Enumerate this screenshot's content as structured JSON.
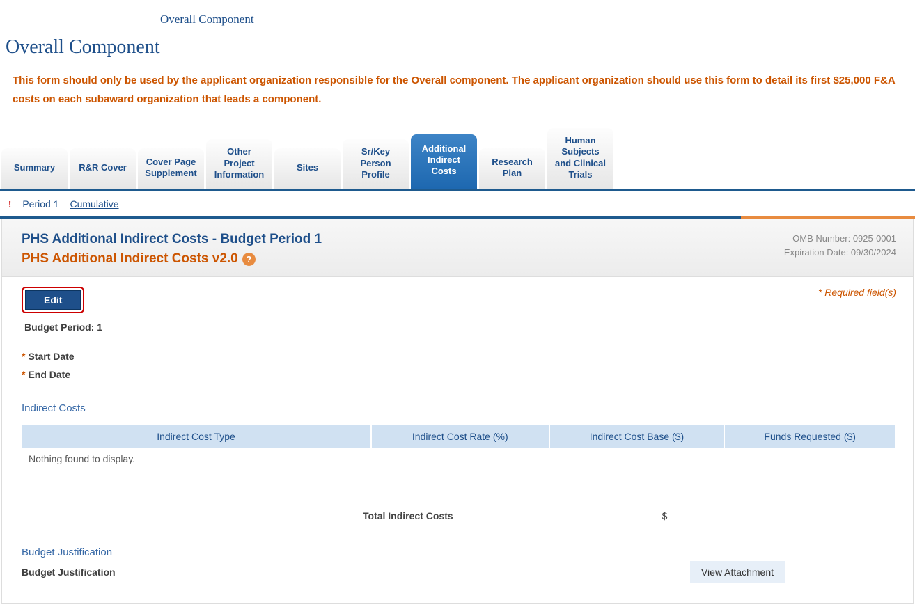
{
  "breadcrumb": "Overall Component",
  "page_title": "Overall Component",
  "warning": "This form should only be used by the applicant organization responsible for the Overall component.  The applicant organization should use this form to detail its first $25,000 F&A costs on each subaward organization that leads a component.",
  "tabs": [
    {
      "label": "Summary"
    },
    {
      "label": "R&R Cover"
    },
    {
      "label": "Cover Page Supplement"
    },
    {
      "label": "Other Project Information"
    },
    {
      "label": "Sites"
    },
    {
      "label": "Sr/Key Person Profile"
    },
    {
      "label": "Additional Indirect Costs"
    },
    {
      "label": "Research Plan"
    },
    {
      "label": "Human Subjects and Clinical Trials"
    }
  ],
  "active_tab_index": 6,
  "subnav": {
    "period1": "Period 1",
    "cumulative": "Cumulative"
  },
  "panel": {
    "title": "PHS Additional Indirect Costs - Budget Period 1",
    "subtitle": "PHS Additional Indirect Costs v2.0",
    "omb_number": "OMB Number: 0925-0001",
    "expiration": "Expiration Date: 09/30/2024"
  },
  "edit_label": "Edit",
  "required_note": "* Required field(s)",
  "budget_period_label": "Budget Period:",
  "budget_period_value": "1",
  "start_date_label": "Start Date",
  "end_date_label": "End Date",
  "indirect_costs_heading": "Indirect Costs",
  "table": {
    "headers": [
      "Indirect Cost Type",
      "Indirect Cost Rate (%)",
      "Indirect Cost Base ($)",
      "Funds Requested ($)"
    ],
    "empty_message": "Nothing found to display."
  },
  "total_label": "Total Indirect Costs",
  "total_value": "$",
  "budget_justification_heading": "Budget Justification",
  "budget_justification_label": "Budget Justification",
  "view_attachment_label": "View Attachment"
}
